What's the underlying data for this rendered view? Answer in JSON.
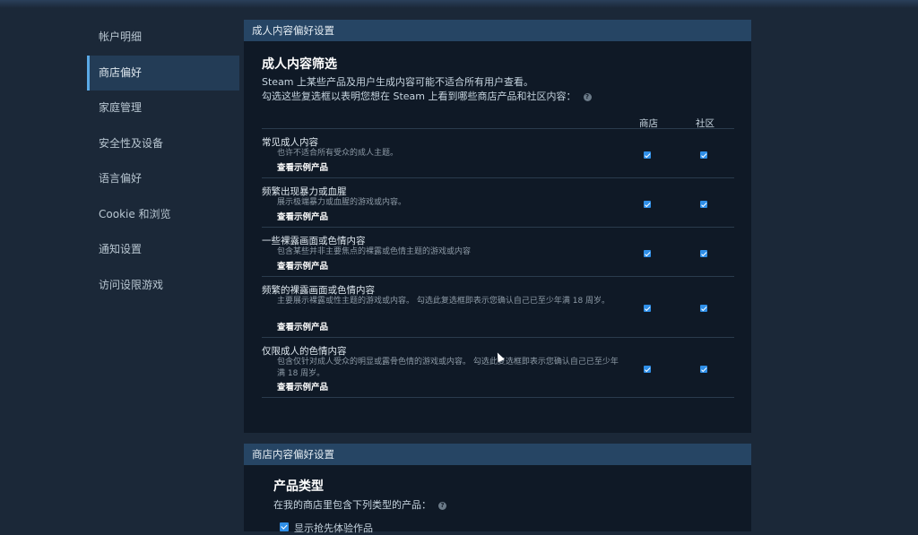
{
  "sidebar": {
    "items": [
      {
        "label": "帐户明细"
      },
      {
        "label": "商店偏好",
        "active": true
      },
      {
        "label": "家庭管理"
      },
      {
        "label": "安全性及设备"
      },
      {
        "label": "语言偏好"
      },
      {
        "label": "Cookie 和浏览"
      },
      {
        "label": "通知设置"
      },
      {
        "label": "访问设限游戏"
      }
    ]
  },
  "adult_panel": {
    "header": "成人内容偏好设置",
    "title": "成人内容筛选",
    "desc1": "Steam 上某些产品及用户生成内容可能不适合所有用户查看。",
    "desc2": "勾选这些复选框以表明您想在 Steam 上看到哪些商店产品和社区内容：",
    "help_icon": "?",
    "columns": {
      "store": "商店",
      "community": "社区"
    },
    "rows": [
      {
        "title": "常见成人内容",
        "desc": "也许不适合所有受众的成人主题。",
        "link": "查看示例产品",
        "store": true,
        "community": true
      },
      {
        "title": "频繁出现暴力或血腥",
        "desc": "展示极端暴力或血腥的游戏或内容。",
        "link": "查看示例产品",
        "store": true,
        "community": true
      },
      {
        "title": "一些裸露画面或色情内容",
        "desc": "包含某些并非主要焦点的裸露或色情主题的游戏或内容",
        "link": "查看示例产品",
        "store": true,
        "community": true
      },
      {
        "title": "频繁的裸露画面或色情内容",
        "desc": "主要展示裸露或性主题的游戏或内容。 勾选此复选框即表示您确认自己已至少年满 18 周岁。",
        "link": "查看示例产品",
        "store": true,
        "community": true
      },
      {
        "title": "仅限成人的色情内容",
        "desc": "包含仅针对成人受众的明显或露骨色情的游戏或内容。 勾选此复选框即表示您确认自己已至少年满 18 周岁。",
        "link": "查看示例产品",
        "store": true,
        "community": true
      }
    ]
  },
  "store_panel": {
    "header": "商店内容偏好设置",
    "title": "产品类型",
    "desc": "在我的商店里包含下列类型的产品：",
    "help_icon": "?",
    "option1": "显示抢先体验作品"
  },
  "colors": {
    "accent": "#2f8fe8",
    "panel_header": "#264564",
    "background": "#1b2838"
  }
}
